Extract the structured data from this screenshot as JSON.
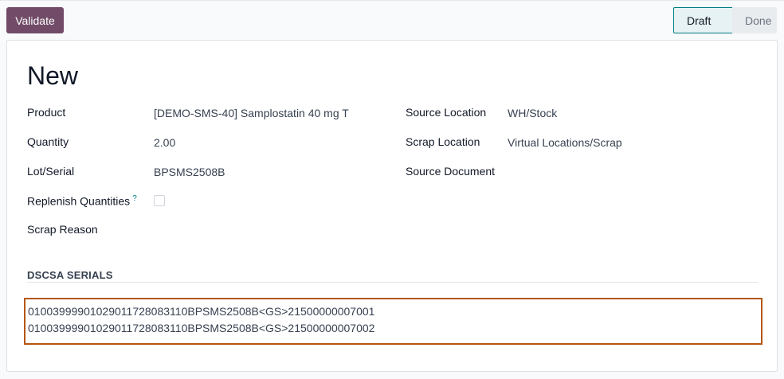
{
  "toolbar": {
    "validate_label": "Validate"
  },
  "statusbar": {
    "states": [
      "Draft",
      "Done"
    ],
    "current": "Draft"
  },
  "form": {
    "title": "New",
    "left_fields": [
      {
        "label": "Product",
        "value": "[DEMO-SMS-40] Samplostatin 40 mg T"
      },
      {
        "label": "Quantity",
        "value": "2.00"
      },
      {
        "label": "Lot/Serial",
        "value": "BPSMS2508B"
      },
      {
        "label": "Replenish Quantities",
        "help": "?",
        "checked": false
      },
      {
        "label": "Scrap Reason",
        "value": ""
      }
    ],
    "right_fields": [
      {
        "label": "Source Location",
        "value": "WH/Stock"
      },
      {
        "label": "Scrap Location",
        "value": "Virtual Locations/Scrap"
      },
      {
        "label": "Source Document",
        "value": ""
      }
    ]
  },
  "dscsa": {
    "section_title": "DSCSA SERIALS",
    "serials": [
      "01003999901029011728083110BPSMS2508B<GS>21500000007001",
      "01003999901029011728083110BPSMS2508B<GS>21500000007002"
    ]
  },
  "colors": {
    "primary": "#714b67",
    "highlight_border": "#b5560e",
    "status_accent": "#017e84"
  }
}
